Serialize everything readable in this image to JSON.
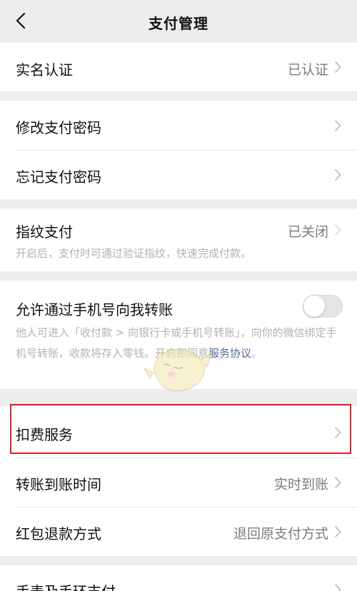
{
  "header": {
    "title": "支付管理"
  },
  "sections": {
    "realname": {
      "label": "实名认证",
      "value": "已认证"
    },
    "password": {
      "change_label": "修改支付密码",
      "forgot_label": "忘记支付密码"
    },
    "fingerprint": {
      "label": "指纹支付",
      "value": "已关闭",
      "description": "开启后，支付时可通过验证指纹，快速完成付款。"
    },
    "phone_transfer": {
      "label": "允许通过手机号向我转账",
      "toggle_on": false,
      "description": "他人可进入「收付款 > 向银行卡或手机号转账」，向你的微信绑定手机号转账，收款将存入零钱。开启即同意",
      "link_text": "服务协议",
      "description_end": "。"
    },
    "services": {
      "deduction_label": "扣费服务",
      "arrival_label": "转账到账时间",
      "arrival_value": "实时到账",
      "refund_label": "红包退款方式",
      "refund_value": "退回原支付方式"
    },
    "watch": {
      "label": "手表及手环支付"
    }
  },
  "icons": {
    "back": "chevron-left-icon",
    "row_arrow": "chevron-right-icon"
  },
  "colors": {
    "background": "#ededed",
    "link": "#576b95",
    "highlight_border": "#d9222a"
  }
}
